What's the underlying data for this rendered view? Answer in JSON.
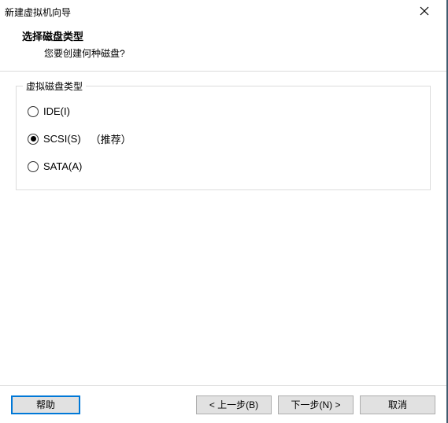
{
  "window": {
    "title": "新建虚拟机向导"
  },
  "header": {
    "heading": "选择磁盘类型",
    "subheading": "您要创建何种磁盘?"
  },
  "fieldset": {
    "legend": "虚拟磁盘类型",
    "options": {
      "ide": {
        "label": "IDE(I)",
        "checked": false
      },
      "scsi": {
        "label": "SCSI(S)",
        "checked": true,
        "suffix": "（推荐）"
      },
      "sata": {
        "label": "SATA(A)",
        "checked": false
      }
    }
  },
  "footer": {
    "help": "帮助",
    "back": "< 上一步(B)",
    "next": "下一步(N) >",
    "cancel": "取消"
  }
}
